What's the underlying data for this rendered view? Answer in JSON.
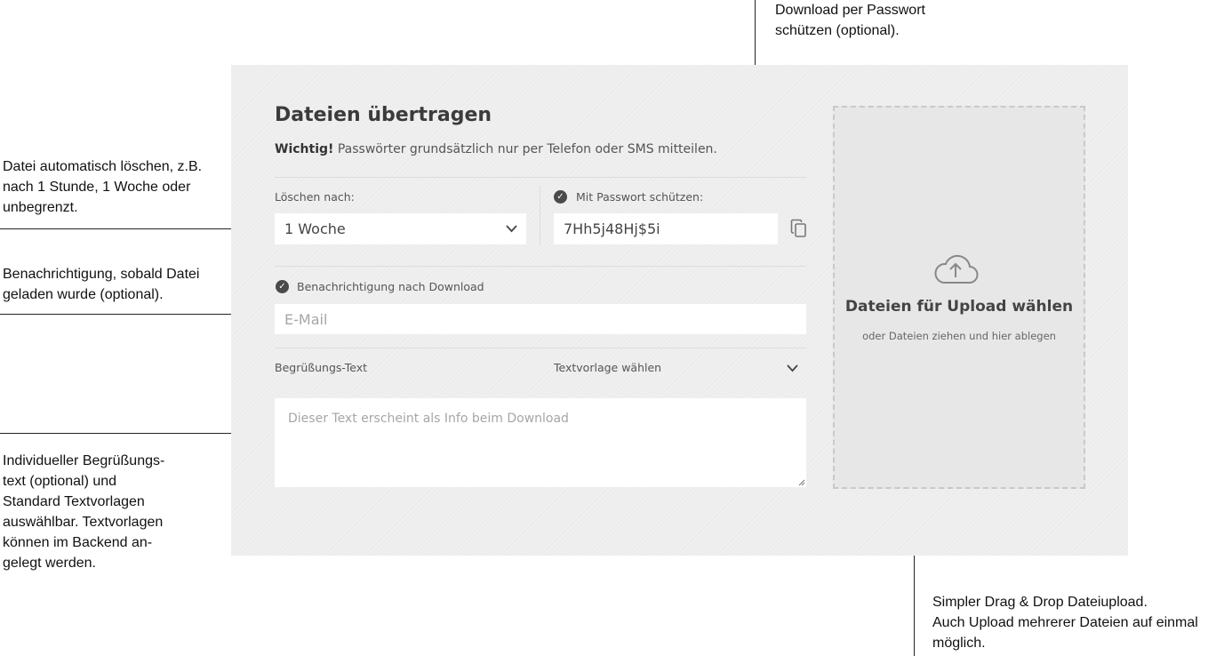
{
  "annotations": {
    "password": "Download per Passwort\nschützen (optional).",
    "delete": "Datei automatisch löschen, z.B.\nnach 1 Stunde, 1 Woche oder\nunbegrenzt.",
    "notify": "Benachrichtigung, sobald Datei\ngeladen wurde (optional).",
    "greeting": "Individueller Begrüßungs-\ntext (optional) und\nStandard Textvorlagen\nauswählbar. Textvorlagen\nkönnen im Backend an-\ngelegt werden.",
    "upload": "Simpler Drag & Drop Dateiupload.\nAuch Upload mehrerer Dateien auf einmal\nmöglich."
  },
  "form": {
    "title": "Dateien übertragen",
    "notice_bold": "Wichtig!",
    "notice_text": " Passwörter grundsätzlich nur per Telefon oder SMS mitteilen.",
    "delete_label": "Löschen nach:",
    "delete_value": "1 Woche",
    "password_label": "Mit Passwort schützen:",
    "password_value": "7Hh5j48Hj$5i",
    "notify_label": "Benachrichtigung nach Download",
    "email_placeholder": "E-Mail",
    "greeting_label": "Begrüßungs-Text",
    "template_label": "Textvorlage wählen",
    "greeting_placeholder": "Dieser Text erscheint als Info beim Download"
  },
  "upload": {
    "title": "Dateien für Upload wählen",
    "subtitle": "oder Dateien ziehen und hier ablegen"
  },
  "icons": [
    "chevron-down-icon",
    "copy-icon",
    "check-circle-icon",
    "cloud-upload-icon",
    "resize-handle-icon"
  ]
}
